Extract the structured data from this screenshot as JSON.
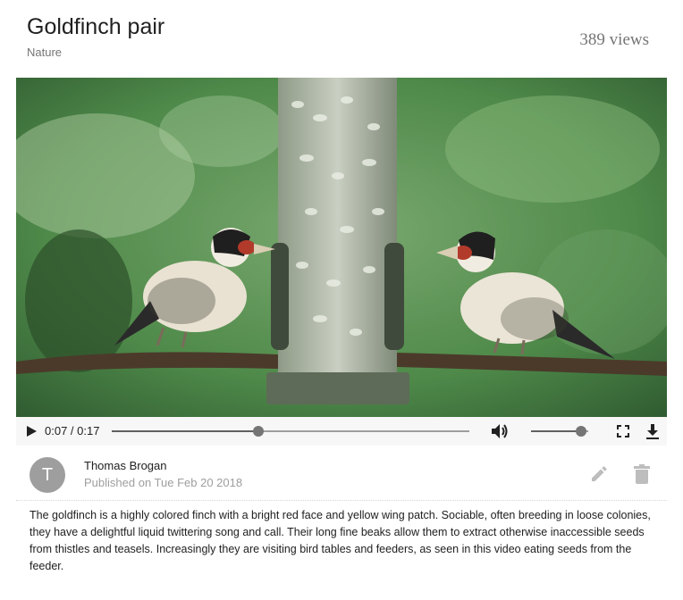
{
  "video": {
    "title": "Goldfinch pair",
    "category": "Nature",
    "views": "389 views"
  },
  "player": {
    "time_display": "0:07 / 0:17",
    "progress_fraction": 0.41,
    "volume_fraction": 0.88,
    "icons": [
      "play-icon",
      "volume-icon",
      "fullscreen-icon",
      "download-icon"
    ]
  },
  "author": {
    "avatar_initial": "T",
    "name": "Thomas Brogan",
    "published": "Published on Tue Feb 20 2018"
  },
  "actions": {
    "icons": [
      "edit-pencil-icon",
      "delete-trash-icon"
    ]
  },
  "description": "The goldfinch is a highly colored finch with a bright red face and yellow wing patch. Sociable, often breeding in loose colonies, they have a delightful liquid twittering song and call. Their long fine beaks allow them to extract otherwise inaccessible seeds from thistles and teasels. Increasingly they are visiting bird tables and feeders, as seen in this video eating seeds from the feeder.",
  "colors": {
    "primary_text": "#212121",
    "secondary_text": "#757575",
    "muted_text": "#9e9e9e",
    "controls_bg": "#f7f7f7"
  }
}
